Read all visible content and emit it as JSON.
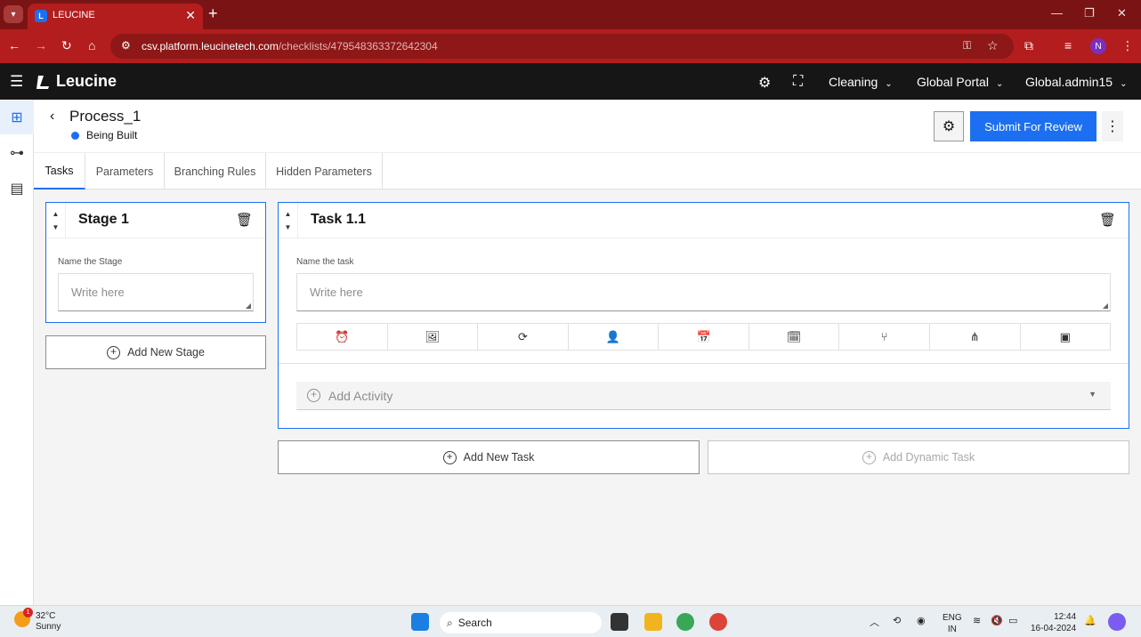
{
  "browser": {
    "tab_title": "LEUCINE",
    "url_host": "csv.platform.leucinetech.com",
    "url_path": "/checklists/479548363372642304",
    "profile_initial": "N"
  },
  "app": {
    "brand": "Leucine",
    "facility": "Cleaning",
    "portal": "Global Portal",
    "user": "Global.admin15"
  },
  "page": {
    "title": "Process_1",
    "status": "Being Built",
    "submit_label": "Submit For Review"
  },
  "tabs": [
    {
      "label": "Tasks"
    },
    {
      "label": "Parameters"
    },
    {
      "label": "Branching Rules"
    },
    {
      "label": "Hidden Parameters"
    }
  ],
  "stage": {
    "title": "Stage 1",
    "field_label": "Name the Stage",
    "placeholder": "Write here",
    "add_label": "Add New Stage"
  },
  "task": {
    "title": "Task 1.1",
    "field_label": "Name the task",
    "placeholder": "Write here",
    "add_activity_label": "Add Activity",
    "add_task_label": "Add New Task",
    "add_dynamic_label": "Add Dynamic Task"
  },
  "task_toolbar_icons": [
    "timer-icon",
    "media-icon",
    "recurrence-icon",
    "assignee-icon",
    "schedule-icon",
    "due-date-icon",
    "branching-icon",
    "interlock-icon",
    "solution-icon"
  ],
  "taskbar": {
    "temperature": "32°C",
    "weather": "Sunny",
    "weather_alert_count": "1",
    "search_label": "Search",
    "lang_line1": "ENG",
    "lang_line2": "IN",
    "time": "12:44",
    "date": "16-04-2024"
  },
  "colors": {
    "browser_frame": "#b31d1d",
    "accent": "#1d6ff2",
    "header_bg": "#161616"
  }
}
